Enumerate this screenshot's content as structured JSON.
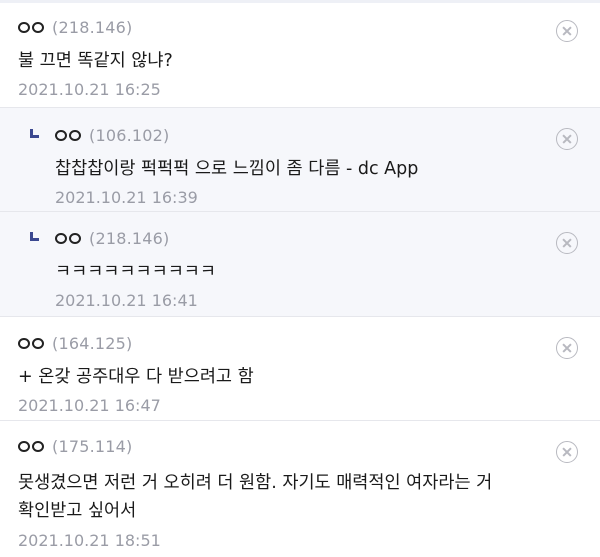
{
  "comments": [
    {
      "nick": "ㅇㅇ",
      "ip": "(218.146)",
      "text": "불 끄면 똑같지 않냐?",
      "date": "2021.10.21 16:25",
      "is_reply": false
    },
    {
      "nick": "ㅇㅇ",
      "ip": "(106.102)",
      "text": "찹찹찹이랑 퍽퍽퍽 으로 느낌이 좀 다름 - dc App",
      "date": "2021.10.21 16:39",
      "is_reply": true
    },
    {
      "nick": "ㅇㅇ",
      "ip": "(218.146)",
      "text": "ㅋㅋㅋㅋㅋㅋㅋㅋㅋㅋ",
      "date": "2021.10.21 16:41",
      "is_reply": true
    },
    {
      "nick": "ㅇㅇ",
      "ip": "(164.125)",
      "text": "+ 온갖 공주대우 다 받으려고 함",
      "date": "2021.10.21 16:47",
      "is_reply": false
    },
    {
      "nick": "ㅇㅇ",
      "ip": "(175.114)",
      "text": "못생겼으면 저런 거 오히려 더 원함. 자기도 매력적인 여자라는 거 확인받고 싶어서",
      "date": "2021.10.21 18:51",
      "is_reply": false
    }
  ],
  "icons": {
    "reply": "reply-arrow-icon",
    "delete": "close-circle-icon"
  },
  "colors": {
    "reply_background": "#f6f7fb",
    "meta_text": "#9a9ca6",
    "reply_arrow": "#3b4890"
  }
}
